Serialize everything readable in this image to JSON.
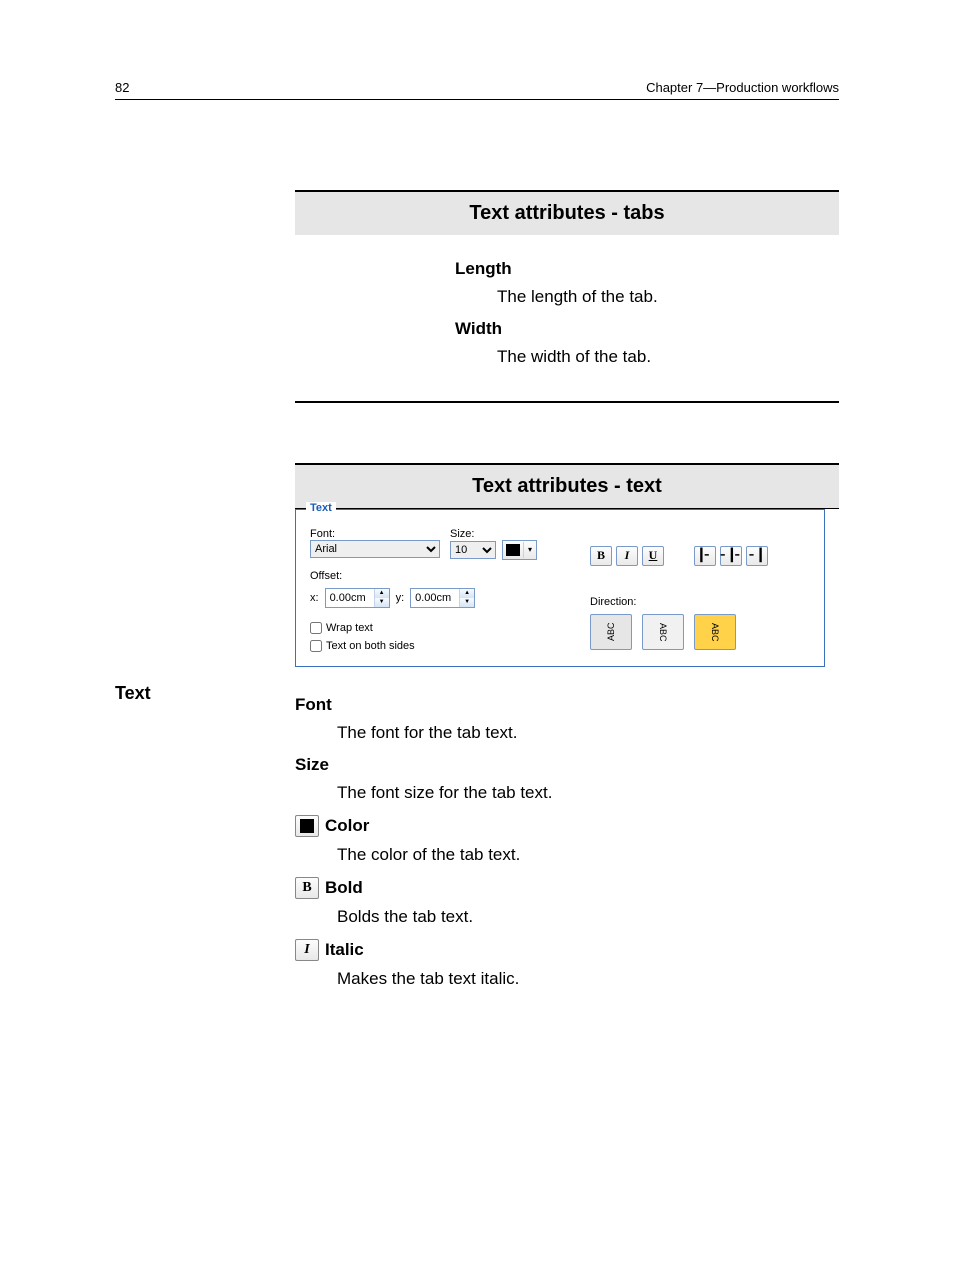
{
  "header": {
    "page_number": "82",
    "chapter": "Chapter 7—Production workflows"
  },
  "section_tabs": {
    "title": "Text attributes - tabs",
    "length_label": "Length",
    "length_desc": "The length of the tab.",
    "width_label": "Width",
    "width_desc": "The width of the tab."
  },
  "section_text": {
    "title": "Text attributes - text",
    "side_label": "Text"
  },
  "panel": {
    "legend": "Text",
    "font_label": "Font:",
    "font_value": "Arial",
    "size_label": "Size:",
    "size_value": "10",
    "offset_label": "Offset:",
    "offset_x_label": "x:",
    "offset_x_value": "0.00cm",
    "offset_y_label": "y:",
    "offset_y_value": "0.00cm",
    "wrap_label": "Wrap text",
    "both_sides_label": "Text on both sides",
    "direction_label": "Direction:",
    "dir_abc": "ABC"
  },
  "defs": {
    "font_label": "Font",
    "font_desc": "The font for the tab text.",
    "size_label": "Size",
    "size_desc": "The font size for the tab text.",
    "color_label": "Color",
    "color_desc": "The color of the tab text.",
    "bold_label": "Bold",
    "bold_desc": "Bolds the tab text.",
    "italic_label": "Italic",
    "italic_desc": "Makes the tab text italic."
  }
}
